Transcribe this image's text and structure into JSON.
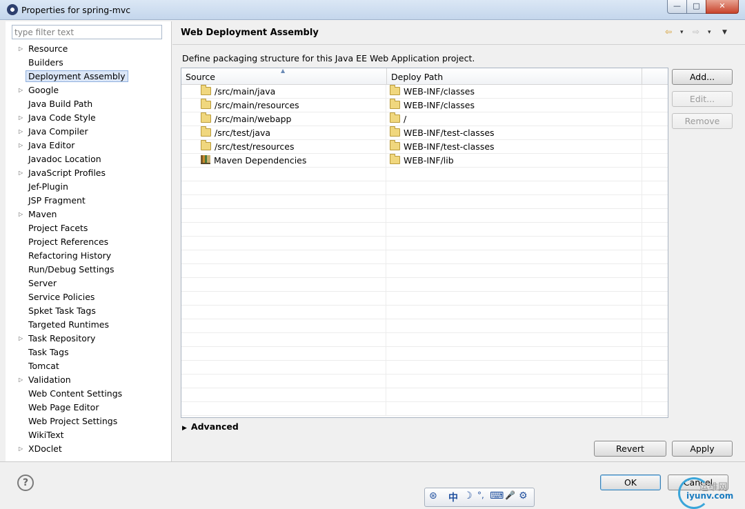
{
  "window": {
    "title": "Properties for spring-mvc",
    "min_glyph": "—",
    "max_glyph": "□",
    "close_glyph": "✕"
  },
  "sidebar": {
    "filter_placeholder": "type filter text",
    "items": [
      {
        "label": "Resource",
        "expandable": true
      },
      {
        "label": "Builders",
        "expandable": false
      },
      {
        "label": "Deployment Assembly",
        "expandable": false,
        "selected": true
      },
      {
        "label": "Google",
        "expandable": true
      },
      {
        "label": "Java Build Path",
        "expandable": false
      },
      {
        "label": "Java Code Style",
        "expandable": true
      },
      {
        "label": "Java Compiler",
        "expandable": true
      },
      {
        "label": "Java Editor",
        "expandable": true
      },
      {
        "label": "Javadoc Location",
        "expandable": false
      },
      {
        "label": "JavaScript Profiles",
        "expandable": true
      },
      {
        "label": "Jef-Plugin",
        "expandable": false
      },
      {
        "label": "JSP Fragment",
        "expandable": false
      },
      {
        "label": "Maven",
        "expandable": true
      },
      {
        "label": "Project Facets",
        "expandable": false
      },
      {
        "label": "Project References",
        "expandable": false
      },
      {
        "label": "Refactoring History",
        "expandable": false
      },
      {
        "label": "Run/Debug Settings",
        "expandable": false
      },
      {
        "label": "Server",
        "expandable": false
      },
      {
        "label": "Service Policies",
        "expandable": false
      },
      {
        "label": "Spket Task Tags",
        "expandable": false
      },
      {
        "label": "Targeted Runtimes",
        "expandable": false
      },
      {
        "label": "Task Repository",
        "expandable": true
      },
      {
        "label": "Task Tags",
        "expandable": false
      },
      {
        "label": "Tomcat",
        "expandable": false
      },
      {
        "label": "Validation",
        "expandable": true
      },
      {
        "label": "Web Content Settings",
        "expandable": false
      },
      {
        "label": "Web Page Editor",
        "expandable": false
      },
      {
        "label": "Web Project Settings",
        "expandable": false
      },
      {
        "label": "WikiText",
        "expandable": false
      },
      {
        "label": "XDoclet",
        "expandable": true
      }
    ]
  },
  "page": {
    "title": "Web Deployment Assembly",
    "description": "Define packaging structure for this Java EE Web Application project.",
    "nav_icons": {
      "back": "⇦",
      "back_menu": "▾",
      "forward": "⇨",
      "forward_menu": "▾",
      "view_menu": "▼"
    },
    "table": {
      "columns": [
        "Source",
        "Deploy Path"
      ],
      "sort_indicator": "▲",
      "rows": [
        {
          "source": "/src/main/java",
          "source_icon": "folder-icon",
          "deploy": "WEB-INF/classes"
        },
        {
          "source": "/src/main/resources",
          "source_icon": "folder-icon",
          "deploy": "WEB-INF/classes"
        },
        {
          "source": "/src/main/webapp",
          "source_icon": "folder-icon",
          "deploy": "/"
        },
        {
          "source": "/src/test/java",
          "source_icon": "folder-icon",
          "deploy": "WEB-INF/test-classes"
        },
        {
          "source": "/src/test/resources",
          "source_icon": "folder-icon",
          "deploy": "WEB-INF/test-classes"
        },
        {
          "source": "Maven Dependencies",
          "source_icon": "library-icon",
          "deploy": "WEB-INF/lib"
        }
      ],
      "empty_rows": 18
    },
    "buttons": {
      "add": "Add...",
      "edit": "Edit...",
      "remove": "Remove"
    },
    "advanced_label": "Advanced",
    "advanced_glyph": "▶",
    "revert": "Revert",
    "apply": "Apply"
  },
  "dialog": {
    "help_glyph": "?",
    "ok": "OK",
    "cancel": "Cancel"
  },
  "ime_toolbar": {
    "glyphs": [
      "⊛",
      "中",
      "☽",
      "°,",
      "⌨",
      "🎤",
      "⚙"
    ]
  },
  "watermark": {
    "line1": "运维网",
    "line2": "iyunv.com"
  }
}
